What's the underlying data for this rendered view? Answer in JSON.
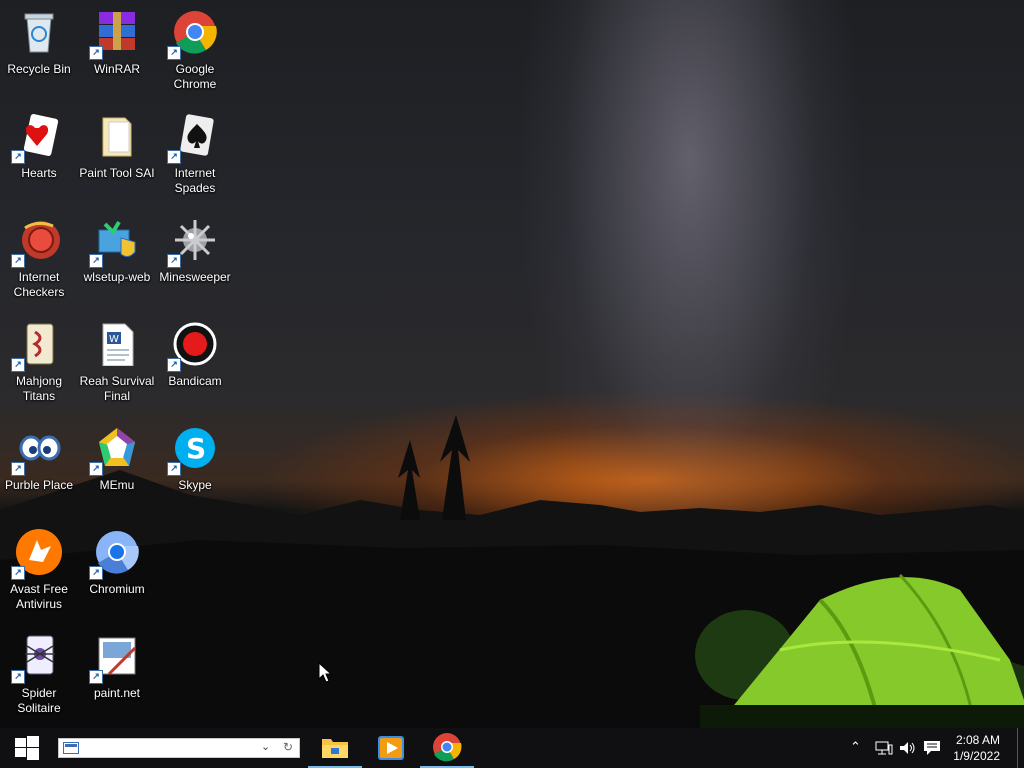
{
  "desktop": {
    "icons": [
      {
        "label": "Recycle Bin",
        "icon": "recycle-bin-icon"
      },
      {
        "label": "WinRAR",
        "icon": "winrar-icon"
      },
      {
        "label": "Google Chrome",
        "icon": "google-chrome-icon"
      },
      {
        "label": "Hearts",
        "icon": "hearts-icon"
      },
      {
        "label": "Paint Tool SAI",
        "icon": "folder-icon"
      },
      {
        "label": "Internet Spades",
        "icon": "internet-spades-icon"
      },
      {
        "label": "Internet Checkers",
        "icon": "internet-checkers-icon"
      },
      {
        "label": "wlsetup-web",
        "icon": "wlsetup-icon"
      },
      {
        "label": "Minesweeper",
        "icon": "minesweeper-icon"
      },
      {
        "label": "Mahjong Titans",
        "icon": "mahjong-icon"
      },
      {
        "label": "Reah Survival Final",
        "icon": "word-document-icon"
      },
      {
        "label": "Bandicam",
        "icon": "bandicam-icon"
      },
      {
        "label": "Purble Place",
        "icon": "purble-place-icon"
      },
      {
        "label": "MEmu",
        "icon": "memu-icon"
      },
      {
        "label": "Skype",
        "icon": "skype-icon"
      },
      {
        "label": "Avast Free Antivirus",
        "icon": "avast-icon"
      },
      {
        "label": "Chromium",
        "icon": "chromium-icon"
      },
      {
        "label": "Spider Solitaire",
        "icon": "spider-solitaire-icon"
      },
      {
        "label": "paint.net",
        "icon": "paint-net-icon"
      }
    ]
  },
  "taskbar": {
    "start_icon": "windows-start-icon",
    "search": {
      "value": "",
      "placeholder": ""
    },
    "pinned": [
      {
        "name": "File Explorer",
        "icon": "file-explorer-icon",
        "active": true
      },
      {
        "name": "Media Player",
        "icon": "media-player-icon",
        "active": false
      },
      {
        "name": "Google Chrome",
        "icon": "google-chrome-icon",
        "active": true
      }
    ],
    "tray": {
      "time": "2:08 AM",
      "date": "1/9/2022"
    }
  },
  "colors": {
    "taskbar": "#101012",
    "accent": "#76b9ed",
    "sky": "#26272c",
    "sunset": "#e06c14",
    "tent": "#8fd12a"
  }
}
